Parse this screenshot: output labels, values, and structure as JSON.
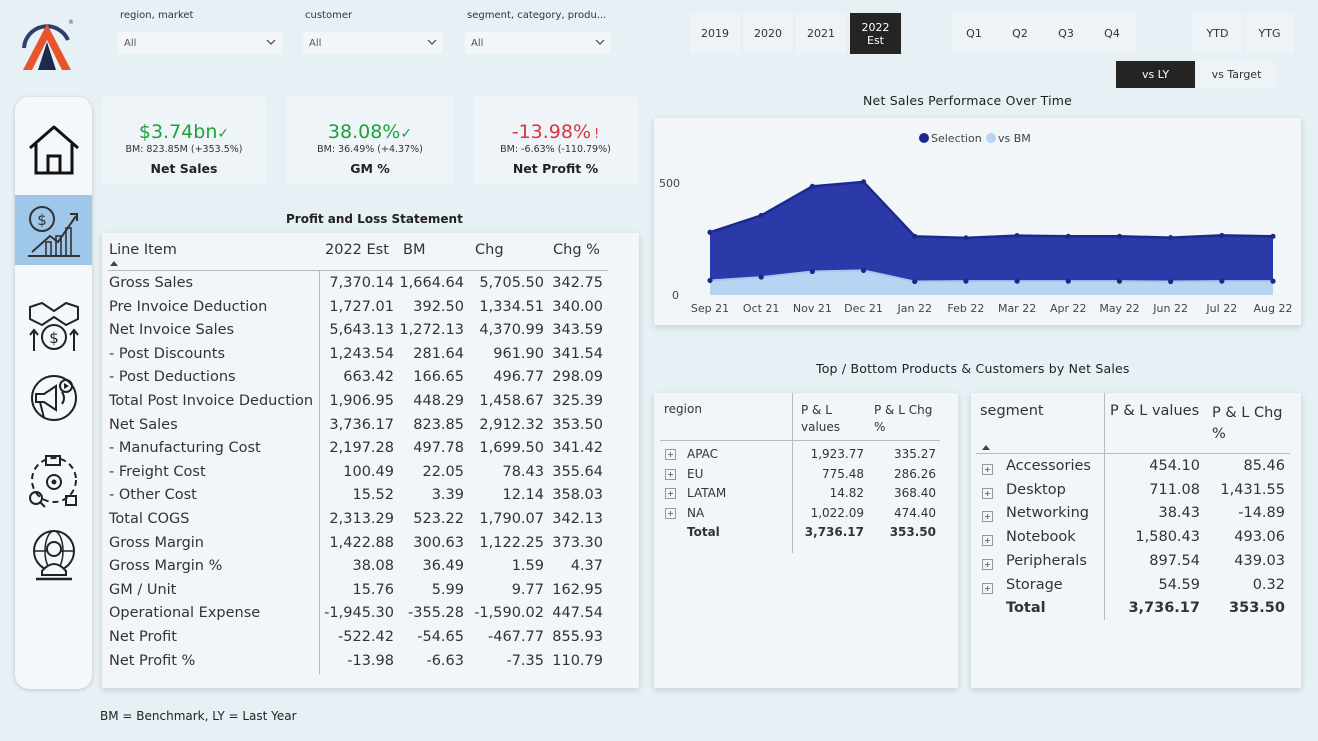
{
  "slicers": [
    {
      "label": "region, market",
      "value": "All"
    },
    {
      "label": "customer",
      "value": "All"
    },
    {
      "label": "segment, category, produ...",
      "value": "All"
    }
  ],
  "years": [
    {
      "label": "2019",
      "active": false
    },
    {
      "label": "2020",
      "active": false
    },
    {
      "label": "2021",
      "active": false
    },
    {
      "label": "2022\nEst",
      "active": true
    }
  ],
  "quarters": [
    "Q1",
    "Q2",
    "Q3",
    "Q4"
  ],
  "ytd": [
    "YTD",
    "YTG"
  ],
  "comparison": {
    "vs_ly": "vs LY",
    "vs_target": "vs Target"
  },
  "kpis": [
    {
      "value": "$3.74bn",
      "mark": "✓",
      "color": "#1ea23c",
      "sub": "BM: 823.85M (+353.5%)",
      "label": "Net Sales"
    },
    {
      "value": "38.08%",
      "mark": "✓",
      "color": "#1ea23c",
      "sub": "BM: 36.49% (+4.37%)",
      "label": "GM %"
    },
    {
      "value": "-13.98%",
      "mark": "!",
      "color": "#d9363e",
      "sub": "BM: -6.63% (-110.79%)",
      "label": "Net Profit %"
    }
  ],
  "pl": {
    "title": "Profit and Loss Statement",
    "headers": [
      "Line Item",
      "2022 Est",
      "BM",
      "Chg",
      "Chg %"
    ],
    "rows": [
      [
        "Gross Sales",
        "7,370.14",
        "1,664.64",
        "5,705.50",
        "342.75"
      ],
      [
        "Pre Invoice Deduction",
        "1,727.01",
        "392.50",
        "1,334.51",
        "340.00"
      ],
      [
        "Net Invoice Sales",
        "5,643.13",
        "1,272.13",
        "4,370.99",
        "343.59"
      ],
      [
        "- Post Discounts",
        "1,243.54",
        "281.64",
        "961.90",
        "341.54"
      ],
      [
        "- Post Deductions",
        "663.42",
        "166.65",
        "496.77",
        "298.09"
      ],
      [
        "Total Post Invoice Deduction",
        "1,906.95",
        "448.29",
        "1,458.67",
        "325.39"
      ],
      [
        "Net Sales",
        "3,736.17",
        "823.85",
        "2,912.32",
        "353.50"
      ],
      [
        "- Manufacturing Cost",
        "2,197.28",
        "497.78",
        "1,699.50",
        "341.42"
      ],
      [
        "- Freight Cost",
        "100.49",
        "22.05",
        "78.43",
        "355.64"
      ],
      [
        "- Other Cost",
        "15.52",
        "3.39",
        "12.14",
        "358.03"
      ],
      [
        "Total COGS",
        "2,313.29",
        "523.22",
        "1,790.07",
        "342.13"
      ],
      [
        "Gross Margin",
        "1,422.88",
        "300.63",
        "1,122.25",
        "373.30"
      ],
      [
        "Gross Margin %",
        "38.08",
        "36.49",
        "1.59",
        "4.37"
      ],
      [
        "GM / Unit",
        "15.76",
        "5.99",
        "9.77",
        "162.95"
      ],
      [
        "Operational Expense",
        "-1,945.30",
        "-355.28",
        "-1,590.02",
        "447.54"
      ],
      [
        "Net Profit",
        "-522.42",
        "-54.65",
        "-467.77",
        "855.93"
      ],
      [
        "Net Profit %",
        "-13.98",
        "-6.63",
        "-7.35",
        "110.79"
      ]
    ]
  },
  "chart_data": {
    "type": "area",
    "title": "Net Sales Performace Over Time",
    "legend": [
      "Selection",
      "vs BM"
    ],
    "legend_position": "top-center",
    "colors": {
      "Selection": "#2b3aa8",
      "vs BM": "#b9d3f2"
    },
    "categories": [
      "Sep 21",
      "Oct 21",
      "Nov 21",
      "Dec 21",
      "Jan 22",
      "Feb 22",
      "Mar 22",
      "Apr 22",
      "May 22",
      "Jun 22",
      "Jul 22",
      "Aug 22"
    ],
    "yticks": [
      "500",
      "0"
    ],
    "ylim": [
      0,
      500
    ],
    "series": [
      {
        "name": "Selection",
        "values": [
          280,
          355,
          485,
          505,
          262,
          255,
          265,
          262,
          262,
          256,
          266,
          262
        ]
      },
      {
        "name": "vs BM",
        "values": [
          65,
          80,
          105,
          110,
          60,
          62,
          62,
          62,
          62,
          60,
          62,
          62
        ]
      }
    ]
  },
  "top_title": "Top / Bottom Products & Customers by Net Sales",
  "region_table": {
    "headers": [
      "region",
      "P & L\nvalues",
      "P & L Chg\n%"
    ],
    "rows": [
      [
        "APAC",
        "1,923.77",
        "335.27"
      ],
      [
        "EU",
        "775.48",
        "286.26"
      ],
      [
        "LATAM",
        "14.82",
        "368.40"
      ],
      [
        "NA",
        "1,022.09",
        "474.40"
      ]
    ],
    "total": [
      "Total",
      "3,736.17",
      "353.50"
    ]
  },
  "segment_table": {
    "headers": [
      "segment",
      "P & L values",
      "P & L Chg\n%"
    ],
    "rows": [
      [
        "Accessories",
        "454.10",
        "85.46"
      ],
      [
        "Desktop",
        "711.08",
        "1,431.55"
      ],
      [
        "Networking",
        "38.43",
        "-14.89"
      ],
      [
        "Notebook",
        "1,580.43",
        "493.06"
      ],
      [
        "Peripherals",
        "897.54",
        "439.03"
      ],
      [
        "Storage",
        "54.59",
        "0.32"
      ]
    ],
    "total": [
      "Total",
      "3,736.17",
      "353.50"
    ]
  },
  "footnote": "BM = Benchmark, LY = Last Year"
}
